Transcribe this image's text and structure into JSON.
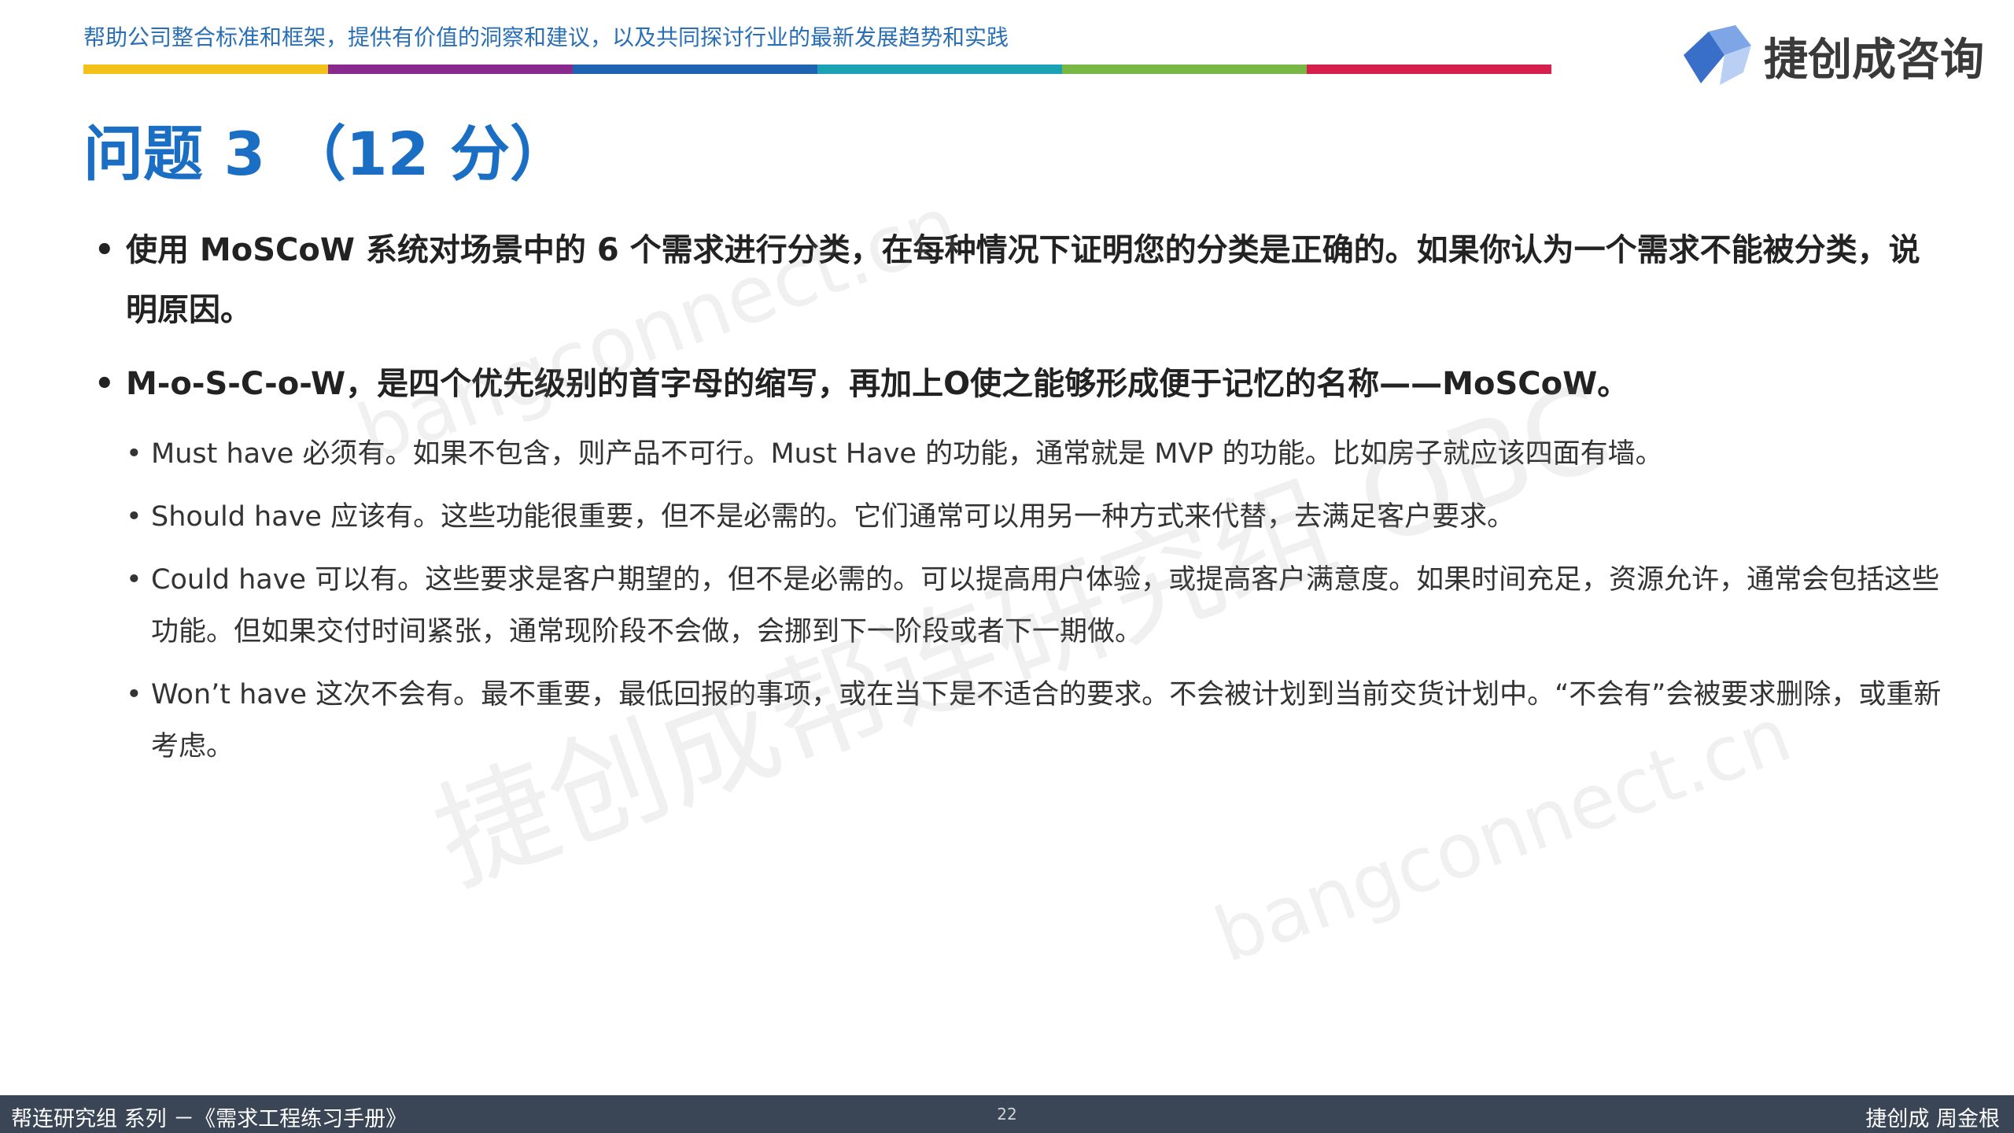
{
  "header": {
    "tagline": "帮助公司整合标准和框架，提供有价值的洞察和建议，以及共同探讨行业的最新发展趋势和实践",
    "color_bar": [
      "#f3c21a",
      "#8a2a8f",
      "#1f63b3",
      "#1ba3b5",
      "#7ab846",
      "#d81e4a"
    ]
  },
  "logo": {
    "text": "捷创成咨询",
    "colors": [
      "#3a6fc9",
      "#7ea5e6",
      "#b9cff3"
    ]
  },
  "title": "问题 3 （12 分）",
  "bullets": [
    {
      "text": "使用 MoSCoW 系统对场景中的 6 个需求进行分类，在每种情况下证明您的分类是正确的。如果你认为一个需求不能被分类，说明原因。",
      "sub": []
    },
    {
      "text": "M-o-S-C-o-W，是四个优先级别的首字母的缩写，再加上O使之能够形成便于记忆的名称——MoSCoW。",
      "sub": [
        "Must have 必须有。如果不包含，则产品不可行。Must Have 的功能，通常就是 MVP 的功能。比如房子就应该四面有墙。",
        "Should have 应该有。这些功能很重要，但不是必需的。它们通常可以用另一种方式来代替，去满足客户要求。",
        "Could have 可以有。这些要求是客户期望的，但不是必需的。可以提高用户体验，或提高客户满意度。如果时间充足，资源允许，通常会包括这些功能。但如果交付时间紧张，通常现阶段不会做，会挪到下一阶段或者下一期做。",
        "Won’t have 这次不会有。最不重要，最低回报的事项，或在当下是不适合的要求。不会被计划到当前交货计划中。“不会有”会被要求删除，或重新考虑。"
      ]
    }
  ],
  "watermarks": {
    "wm1": "bangconnect.cn",
    "wm2": "bangconnect.cn",
    "wm3": "捷创成帮连研究组 OBC"
  },
  "footer": {
    "left": "帮连研究组 系列  －《需求工程练习手册》",
    "page": "22",
    "right": "捷创成 周金根"
  }
}
